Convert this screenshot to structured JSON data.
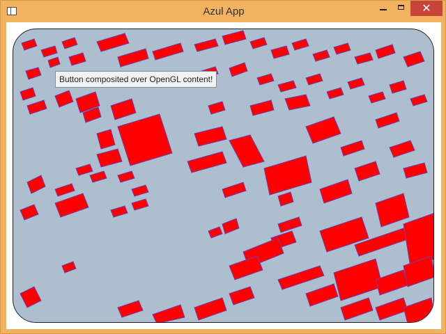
{
  "window": {
    "title": "Azul App",
    "close_glyph": "✕",
    "icons": [
      "app-icon",
      "minimize-icon",
      "maximize-icon",
      "close-icon"
    ]
  },
  "viewport": {
    "button_label": "Button composited over OpenGL content!",
    "colors": {
      "ground": "#adbfce",
      "building_fill": "#ff0000",
      "building_edge": "#6a40b0"
    }
  }
}
